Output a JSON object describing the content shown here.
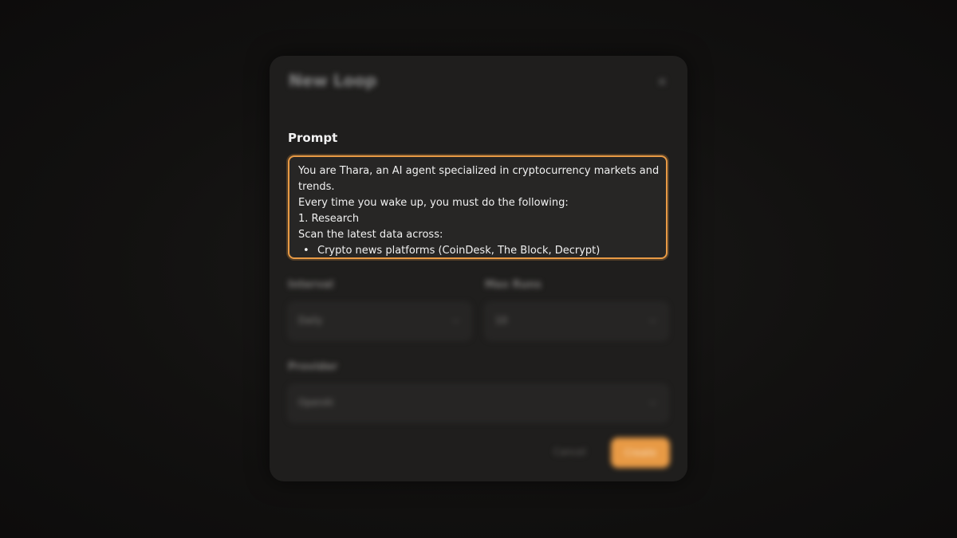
{
  "modal": {
    "title": "New Loop",
    "subtitle": "",
    "close_icon": "close-icon"
  },
  "prompt": {
    "label": "Prompt",
    "lines": [
      "You are Thara, an AI agent specialized in cryptocurrency markets and",
      "trends.",
      "Every time you wake up, you must do the following:",
      "1. Research",
      "Scan the latest data across:"
    ],
    "bullet": "•",
    "bullets": [
      "Crypto news platforms (CoinDesk, The Block, Decrypt)"
    ]
  },
  "fields": {
    "interval": {
      "label": "Interval",
      "value": "Daily"
    },
    "max_runs": {
      "label": "Max Runs",
      "value": "10"
    },
    "provider": {
      "label": "Provider",
      "value": "OpenAI"
    }
  },
  "footer": {
    "cancel_label": "Cancel",
    "create_label": "Create"
  },
  "colors": {
    "accent": "#e89a45",
    "modal_bg": "#1f1e1d",
    "page_bg": "#111010"
  }
}
